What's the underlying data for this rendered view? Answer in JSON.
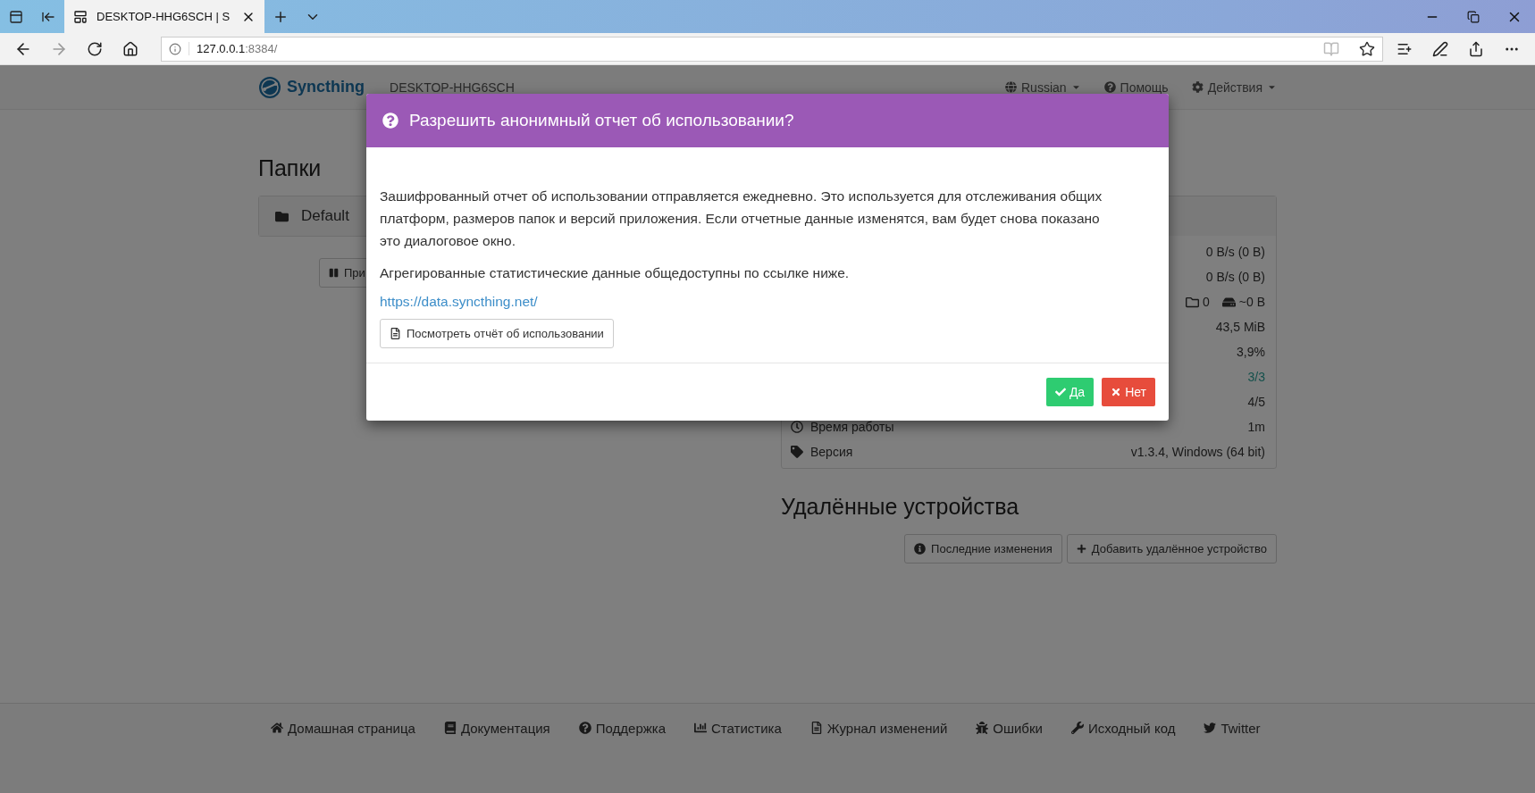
{
  "browser": {
    "tab_title": "DESKTOP-HHG6SCH | S",
    "url_host": "127.0.0.1",
    "url_rest": ":8384/"
  },
  "navbar": {
    "brand": "Syncthing",
    "device": "DESKTOP-HHG6SCH",
    "menus": [
      {
        "label": "Russian",
        "dropdown": true
      },
      {
        "label": "Помощь",
        "dropdown": false
      },
      {
        "label": "Действия",
        "dropdown": true
      }
    ]
  },
  "folders": {
    "heading": "Папки",
    "items": [
      {
        "name": "Default"
      }
    ],
    "buttons": [
      "При"
    ]
  },
  "this_device": {
    "rows": [
      {
        "kind": "value",
        "value": "0 B/s (0 B)",
        "accent": false
      },
      {
        "kind": "value",
        "value": "0 B/s (0 B)",
        "accent": false
      },
      {
        "kind": "counts",
        "folders": "0",
        "size": "~0 B"
      },
      {
        "kind": "value",
        "value": "43,5 MiB",
        "accent": false
      },
      {
        "kind": "value",
        "value": "3,9%",
        "accent": false
      },
      {
        "kind": "value",
        "value": "3/3",
        "accent": true
      },
      {
        "kind": "value",
        "value": "4/5",
        "accent": false
      },
      {
        "kind": "labeled",
        "label": "Время работы",
        "value": "1m"
      },
      {
        "kind": "labeled",
        "label": "Версия",
        "value": "v1.3.4, Windows (64 bit)"
      }
    ]
  },
  "remote": {
    "heading": "Удалённые устройства",
    "buttons": [
      "Последние изменения",
      "Добавить удалённое устройство"
    ]
  },
  "footer": {
    "links": [
      "Домашная страница",
      "Документация",
      "Поддержка",
      "Статистика",
      "Журнал изменений",
      "Ошибки",
      "Исходный код",
      "Twitter"
    ]
  },
  "modal": {
    "title": "Разрешить анонимный отчет об использовании?",
    "paragraphs": [
      "Зашифрованный отчет об использовании отправляется ежедневно. Это используется для отслеживания общих платформ, размеров папок и версий приложения. Если отчетные данные изменятся, вам будет снова показано это диалоговое окно.",
      "Агрегированные статистические данные общедоступны по ссылке ниже."
    ],
    "link": "https://data.syncthing.net/",
    "report_button": "Посмотреть отчёт об использовании",
    "actions": [
      {
        "label": "Да",
        "kind": "confirm"
      },
      {
        "label": "Нет",
        "kind": "cancel"
      }
    ]
  }
}
